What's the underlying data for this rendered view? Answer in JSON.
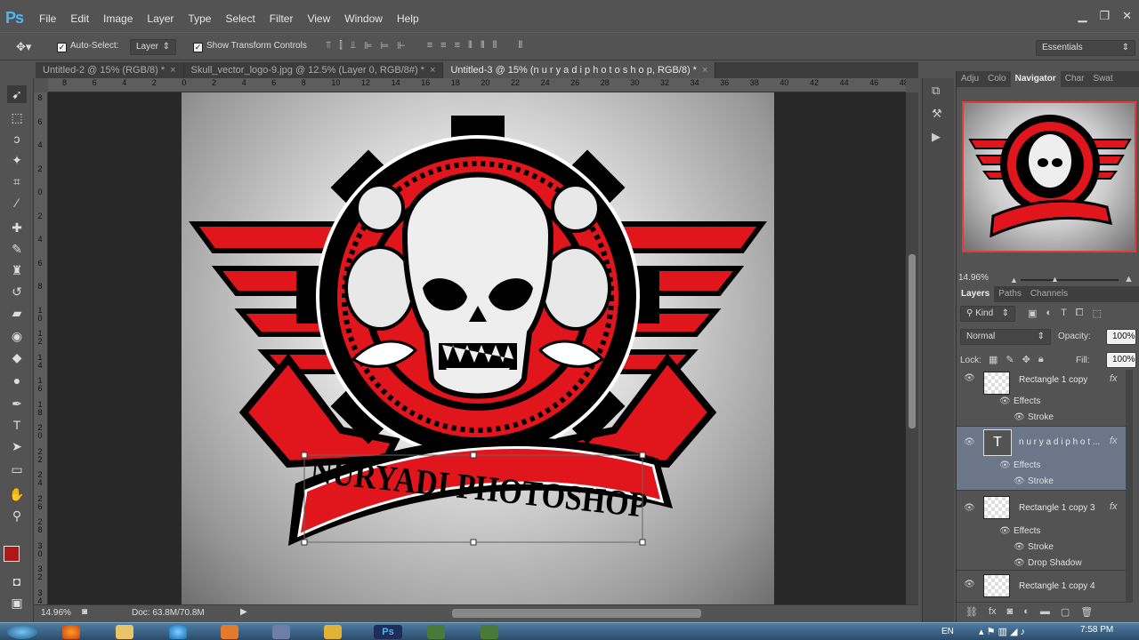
{
  "app": {
    "logo": "Ps",
    "menus": [
      "File",
      "Edit",
      "Image",
      "Layer",
      "Type",
      "Select",
      "Filter",
      "View",
      "Window",
      "Help"
    ]
  },
  "window_controls": {
    "minimize": "▁",
    "restore": "❐",
    "close": "✕"
  },
  "options": {
    "auto_select_label": "Auto-Select:",
    "auto_select_value": "Layer",
    "transform_label": "Show Transform Controls",
    "workspace": "Essentials"
  },
  "tabs": [
    {
      "label": "Untitled-2 @ 15% (RGB/8) *",
      "close": "×"
    },
    {
      "label": "Skull_vector_logo-9.jpg @ 12.5% (Layer 0, RGB/8#) *",
      "close": "×"
    },
    {
      "label": "Untitled-3 @ 15% (n u r y a d i  p h o t o s h o p, RGB/8) *",
      "close": "×"
    }
  ],
  "ruler_h": [
    "8",
    "6",
    "4",
    "2",
    "0",
    "2",
    "4",
    "6",
    "8",
    "10",
    "12",
    "14",
    "16",
    "18",
    "20",
    "22",
    "24",
    "26",
    "28",
    "30",
    "32",
    "34",
    "36",
    "38",
    "40",
    "42",
    "44",
    "46",
    "48"
  ],
  "ruler_v": [
    "8",
    "6",
    "4",
    "2",
    "0",
    "2",
    "4",
    "6",
    "8",
    "1 0",
    "1 2",
    "1 4",
    "1 6",
    "1 8",
    "2 0",
    "2 2",
    "2 4",
    "2 6",
    "2 8",
    "3 0",
    "3 2",
    "3 4"
  ],
  "logo_art": {
    "banner_text": "NURYADI PHOTOSHOP"
  },
  "status": {
    "zoom": "14.96%",
    "doc": "Doc: 63.8M/70.8M"
  },
  "panels": {
    "top_tabs": [
      "Adju",
      "Colo",
      "Navigator",
      "Char",
      "Swat"
    ],
    "nav_zoom": "14.96%",
    "layer_tabs": [
      "Layers",
      "Paths",
      "Channels"
    ],
    "kind": "Kind",
    "blend_mode": "Normal",
    "opacity_label": "Opacity:",
    "opacity": "100%",
    "lock_label": "Lock:",
    "fill_label": "Fill:",
    "fill": "100%",
    "layers": [
      {
        "name": "Rectangle 1 copy",
        "fx": "fx",
        "effects": "Effects",
        "items": [
          "Stroke"
        ]
      },
      {
        "name": "n u r y a d i  p h o t ...",
        "fx": "fx",
        "effects": "Effects",
        "items": [
          "Stroke"
        ]
      },
      {
        "name": "Rectangle 1 copy 3",
        "fx": "fx",
        "effects": "Effects",
        "items": [
          "Stroke",
          "Drop Shadow"
        ]
      },
      {
        "name": "Rectangle 1 copy 4"
      }
    ]
  },
  "taskbar": {
    "lang": "EN",
    "time": "7:58 PM"
  },
  "colors": {
    "accent_red": "#e0161c",
    "fg_swatch": "#b01818",
    "bg_swatch": "#ffffff"
  }
}
